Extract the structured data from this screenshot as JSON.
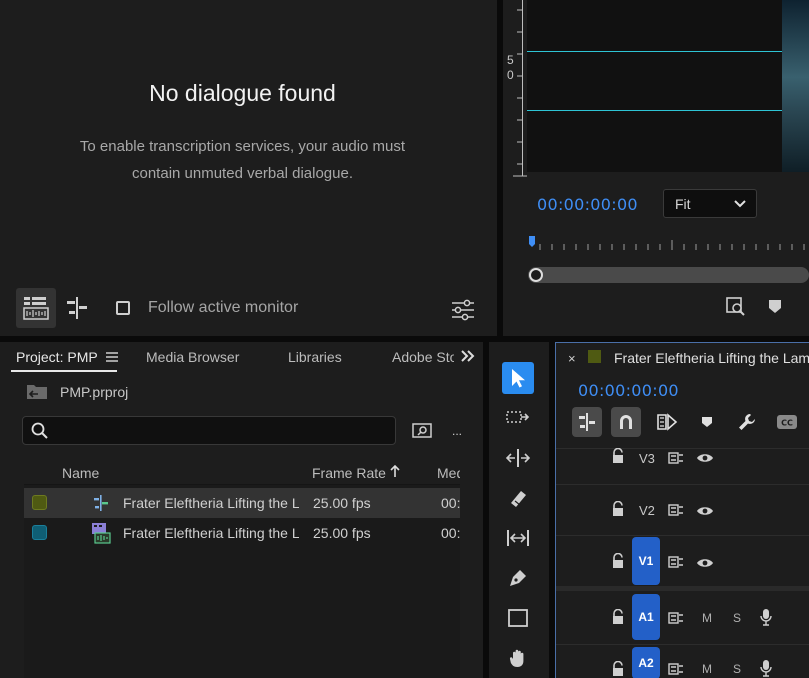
{
  "transcript": {
    "title": "No dialogue found",
    "message_line1": "To enable transcription services, your audio must",
    "message_line2": "contain unmuted verbal dialogue.",
    "follow_label": "Follow active monitor"
  },
  "monitor": {
    "vu_label_5": "5",
    "vu_label_0": "0",
    "timecode": "00:00:00:00",
    "fit_value": "Fit"
  },
  "project": {
    "tabs": [
      "Project: PMP",
      "Media Browser",
      "Libraries",
      "Adobe Sto"
    ],
    "file_name": "PMP.prproj",
    "search_placeholder": "",
    "more": "...",
    "columns": {
      "name": "Name",
      "frame_rate": "Frame Rate",
      "media": "Med"
    },
    "rows": [
      {
        "name": "Frater Eleftheria  Lifting the L",
        "frame_rate": "25.00 fps",
        "media": "00:",
        "color": "#4f5a12"
      },
      {
        "name": "Frater Eleftheria  Lifting the L",
        "frame_rate": "25.00 fps",
        "media": "00:",
        "color": "#0f5e74"
      }
    ]
  },
  "timeline": {
    "title": "Frater Eleftheria  Lifting the Lam",
    "timecode": "00:00:00:00",
    "tracks": [
      {
        "id": "V3",
        "active": false
      },
      {
        "id": "V2",
        "active": false
      },
      {
        "id": "V1",
        "active": true
      },
      {
        "id": "A1",
        "active": true,
        "m": "M",
        "s": "S"
      },
      {
        "id": "A2",
        "active": true,
        "m": "M",
        "s": "S"
      }
    ]
  }
}
